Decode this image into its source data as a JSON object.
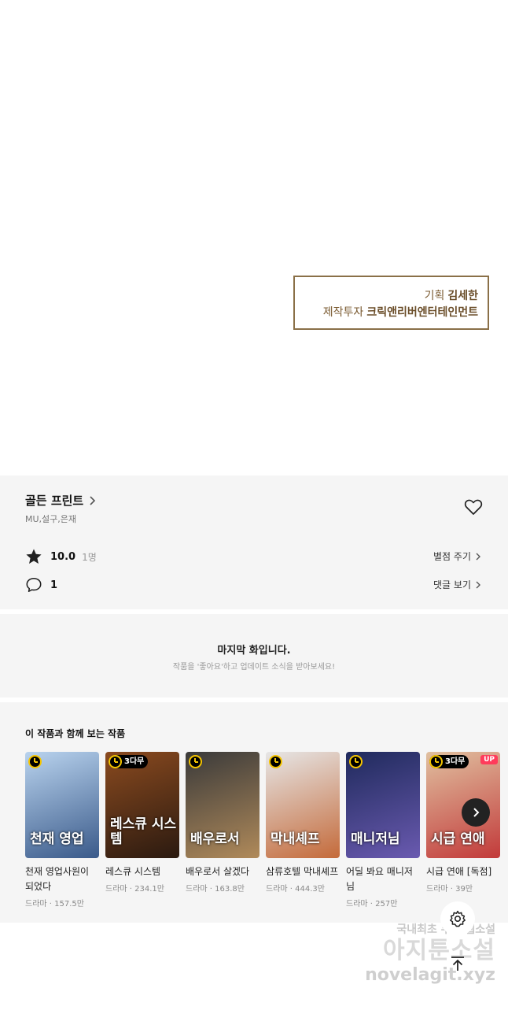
{
  "credit": {
    "line1_label": "기획",
    "line1_value": "김세한",
    "line2_label": "제작투자",
    "line2_value": "크릭앤리버엔터테인먼트"
  },
  "work": {
    "title": "골든 프린트",
    "authors": "MU,설구,은재",
    "rating": "10.0",
    "rating_count": "1명",
    "rate_button": "별점 주기",
    "comment_count": "1",
    "comment_button": "댓글 보기"
  },
  "last_episode": {
    "title": "마지막 화입니다.",
    "subtitle": "작품을 '좋아요'하고 업데이트 소식을 받아보세요!"
  },
  "recommendations": {
    "title": "이 작품과 함께 보는 작품",
    "items": [
      {
        "name": "천재 영업사원이 되었다",
        "meta": "드라마 · 157.5만",
        "badge": "",
        "up": "",
        "cover_text": "천재 영업",
        "color1": "#b9d3ee",
        "color2": "#3a5a8a"
      },
      {
        "name": "레스큐 시스템",
        "meta": "드라마 · 234.1만",
        "badge": "3다무",
        "up": "",
        "cover_text": "레스큐 시스템",
        "color1": "#8a4a1f",
        "color2": "#2b1a10"
      },
      {
        "name": "배우로서 살겠다",
        "meta": "드라마 · 163.8만",
        "badge": "",
        "up": "",
        "cover_text": "배우로서",
        "color1": "#3a3a3a",
        "color2": "#b08a5a"
      },
      {
        "name": "삼류호텔 막내셰프",
        "meta": "드라마 · 444.3만",
        "badge": "",
        "up": "",
        "cover_text": "막내셰프",
        "color1": "#e6e6e6",
        "color2": "#c46a3a"
      },
      {
        "name": "어딜 봐요 매니저님",
        "meta": "드라마 · 257만",
        "badge": "",
        "up": "",
        "cover_text": "매니저님",
        "color1": "#1f2a5c",
        "color2": "#6a5ab0"
      },
      {
        "name": "시급 연애 [독점]",
        "meta": "드라마 · 39만",
        "badge": "3다무",
        "up": "UP",
        "cover_text": "시급 연애",
        "color1": "#e0c0a0",
        "color2": "#c23a3a"
      }
    ]
  },
  "watermark": {
    "line1": "국내최초 무료 웹소설",
    "line2": "아지툰소설",
    "line3": "novelagit.xyz"
  },
  "icons": [
    "chevron-right-icon",
    "heart-icon",
    "star-icon",
    "comment-icon",
    "clock-icon",
    "settings-icon",
    "arrow-up-icon"
  ],
  "colors": {
    "accent_badge": "#f4c400",
    "up_badge": "#ff3b5b",
    "credit_border": "#8a7048"
  }
}
